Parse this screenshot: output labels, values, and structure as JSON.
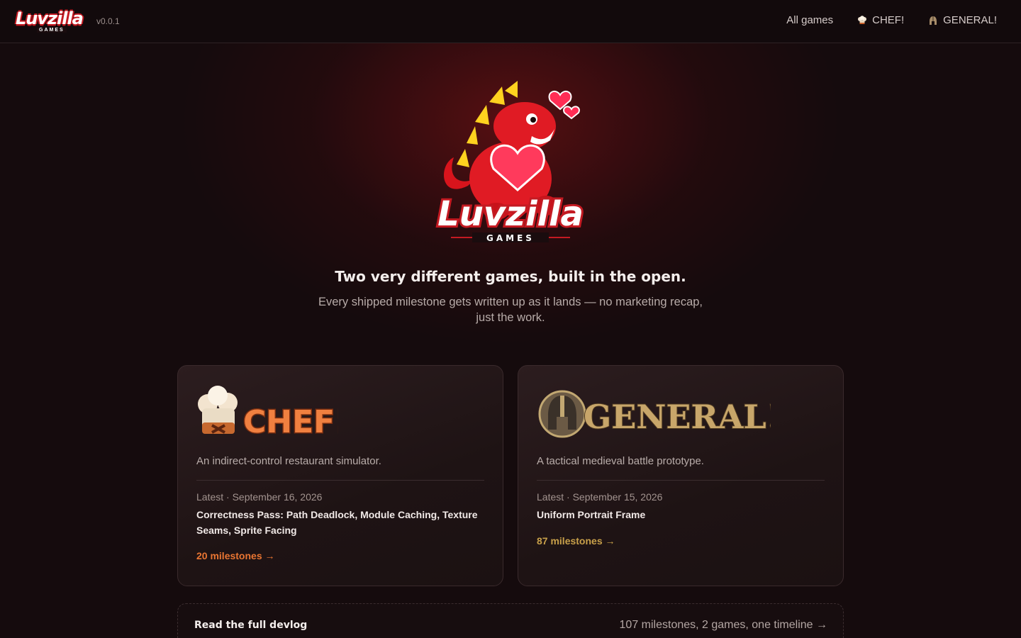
{
  "header": {
    "brand_word": "Luvzilla",
    "brand_sub": "GAMES",
    "version": "v0.0.1",
    "nav": [
      {
        "label": "All games",
        "icon": ""
      },
      {
        "label": "CHEF!",
        "icon": "chef-hat-icon"
      },
      {
        "label": "GENERAL!",
        "icon": "helmet-icon"
      }
    ]
  },
  "hero": {
    "logo_word": "Luvzilla",
    "logo_sub": "GAMES",
    "title": "Two very different games, built in the open.",
    "subtitle": "Every shipped milestone gets written up as it lands — no marketing recap, just the work."
  },
  "cards": [
    {
      "logo_text": "CHEF!",
      "description": "An indirect-control restaurant simulator.",
      "latest": "Latest · September 16, 2026",
      "title": "Correctness Pass: Path Deadlock, Module Caching, Texture Seams, Sprite Facing",
      "link": "20 milestones →",
      "accent": "#e97532"
    },
    {
      "logo_text": "GENERAL!",
      "description": "A tactical medieval battle prototype.",
      "latest": "Latest · September 15, 2026",
      "title": "Uniform Portrait Frame",
      "link": "87 milestones →",
      "accent": "#c8a04a"
    }
  ],
  "devlog": {
    "title": "Read the full devlog",
    "meta": "107 milestones, 2 games, one timeline →"
  }
}
